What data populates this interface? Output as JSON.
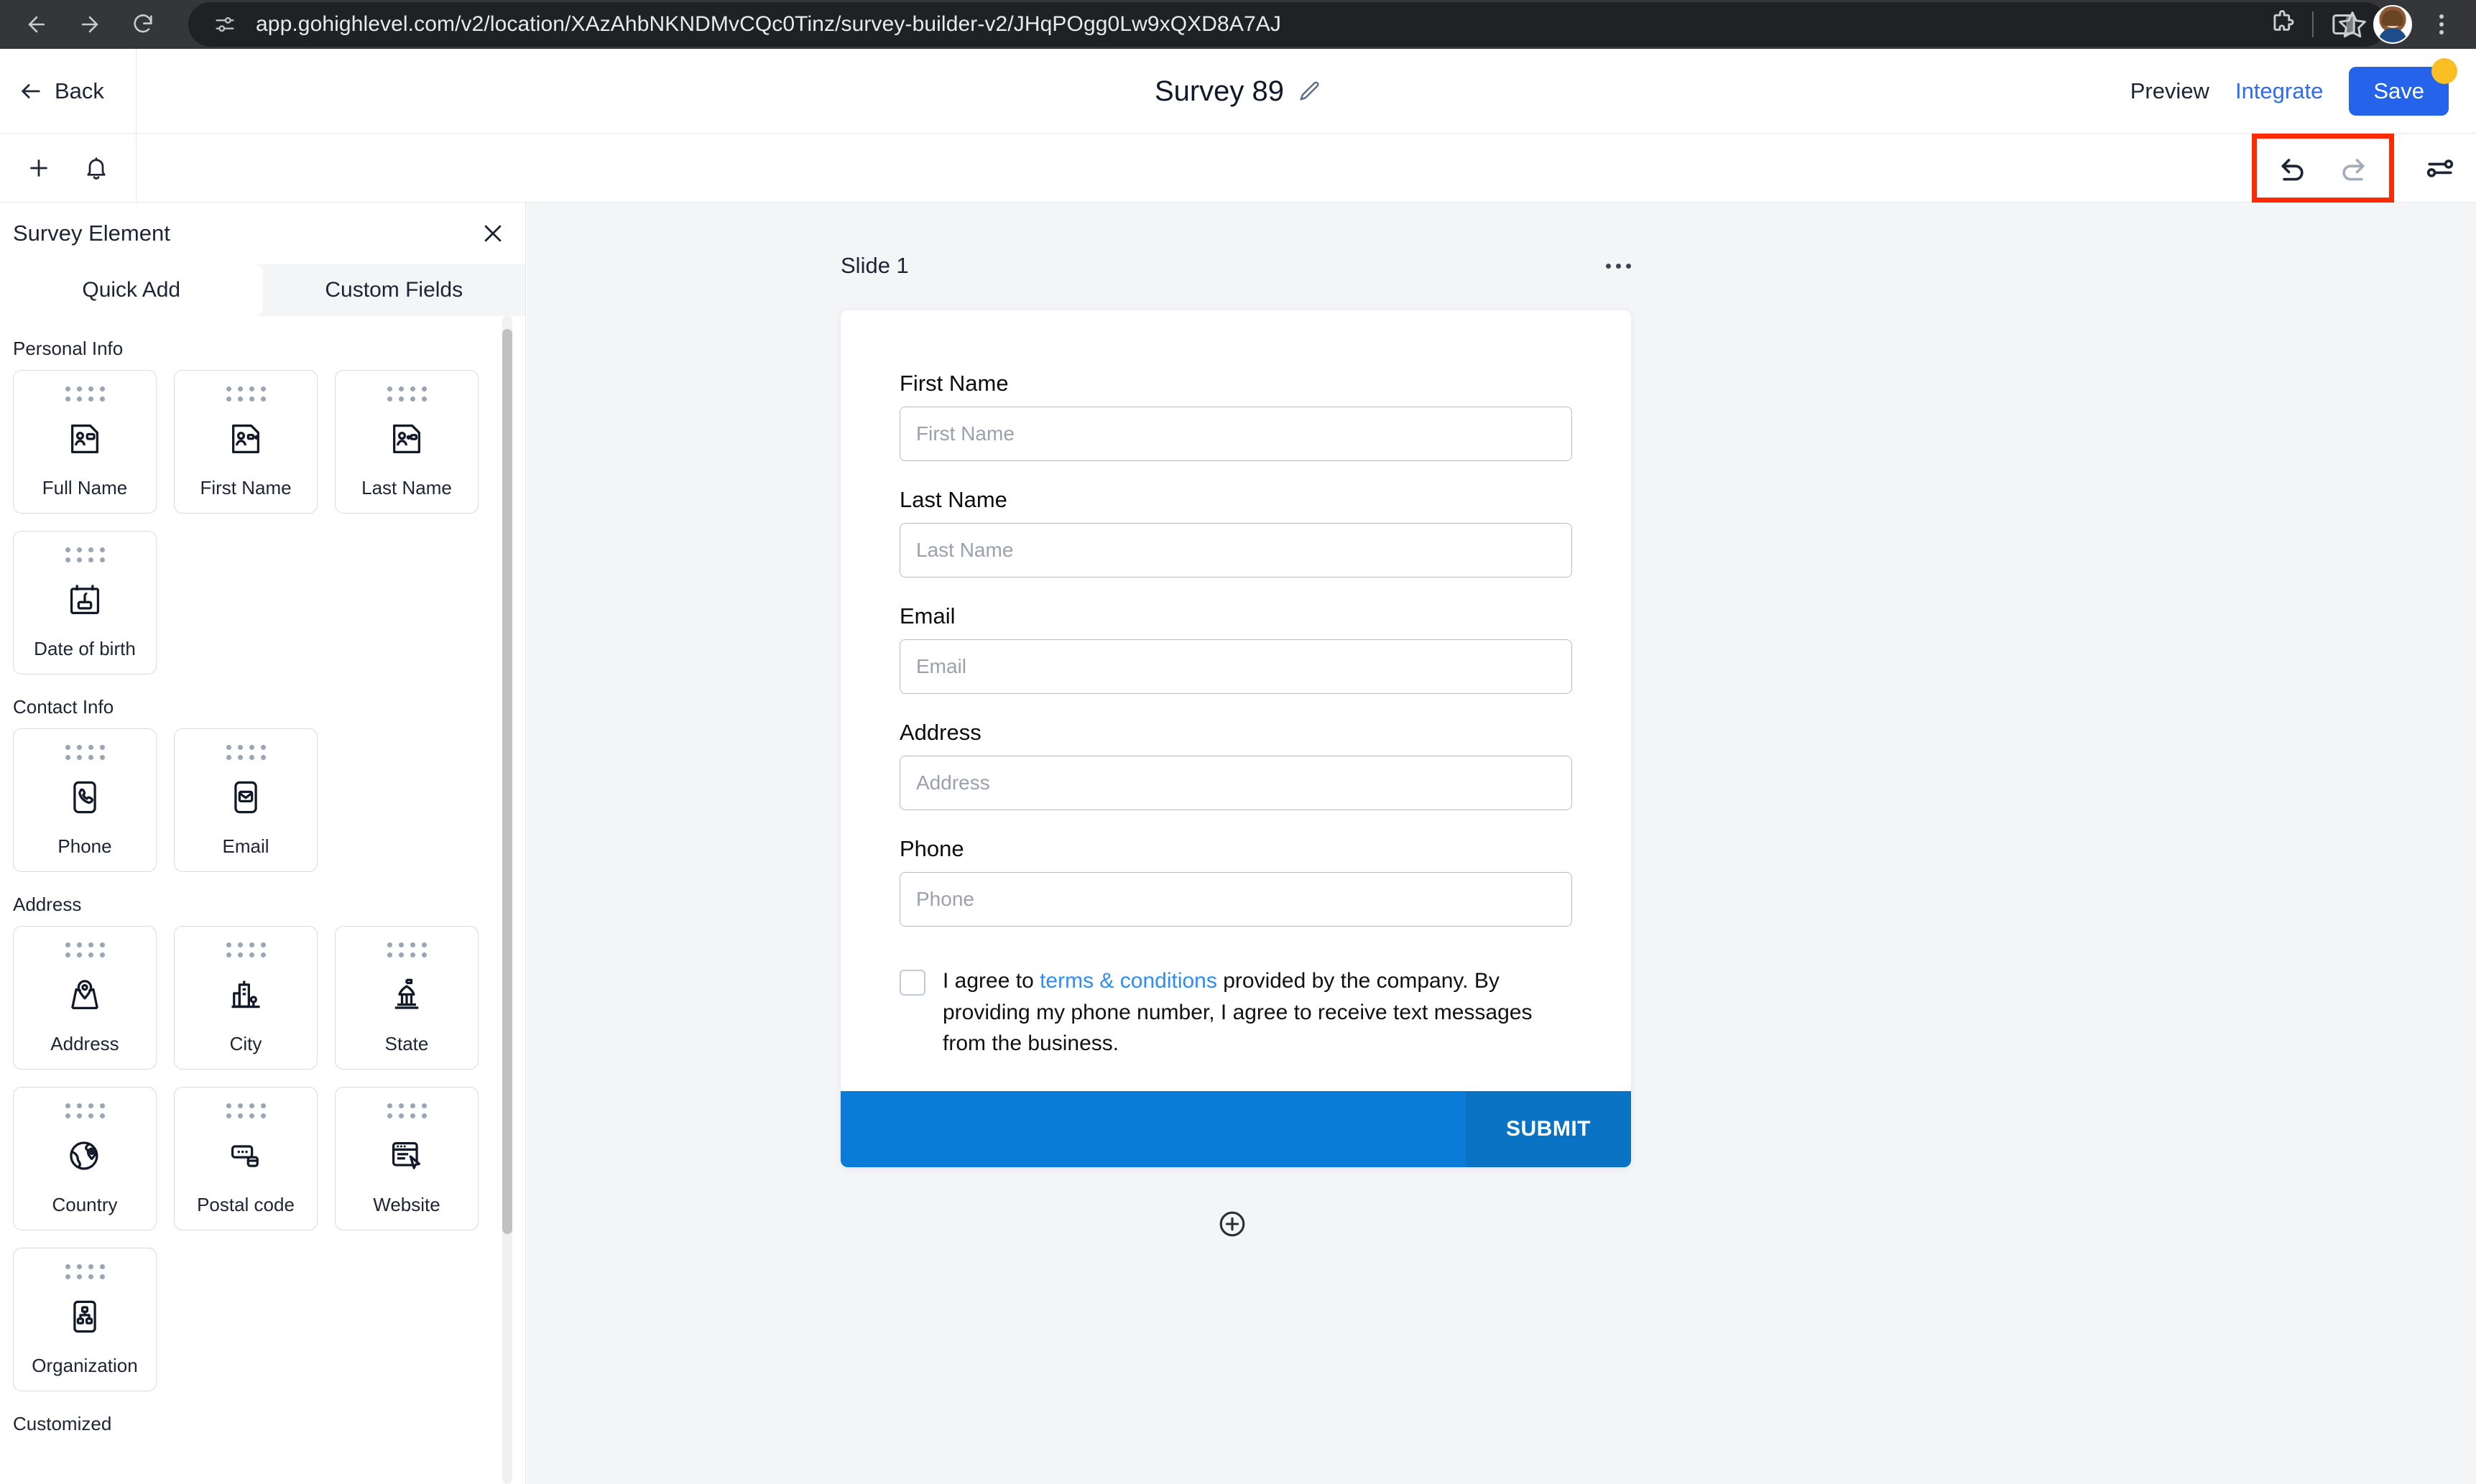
{
  "browser": {
    "url": "app.gohighlevel.com/v2/location/XAzAhbNKNDMvCQc0Tinz/survey-builder-v2/JHqPOgg0Lw9xQXD8A7AJ",
    "back_icon": "arrow-left-icon",
    "forward_icon": "arrow-right-icon",
    "reload_icon": "reload-icon",
    "site_info_icon": "site-settings-icon",
    "bookmark_icon": "star-icon",
    "extensions_icon": "puzzle-piece-icon",
    "side_panel_icon": "side-panel-icon",
    "profile_icon": "profile-avatar",
    "menu_icon": "kebab-menu-icon"
  },
  "header": {
    "back_label": "Back",
    "title": "Survey 89",
    "edit_icon": "pencil-icon",
    "preview_label": "Preview",
    "integrate_label": "Integrate",
    "save_label": "Save",
    "unsaved_indicator": "unsaved-dot",
    "save_color": "#2563eb",
    "unsaved_color": "#fbbf24",
    "integrate_color": "#2f6bf3"
  },
  "toolbar": {
    "add_icon": "plus-icon",
    "notification_icon": "bell-icon",
    "undo_icon": "undo-icon",
    "redo_icon": "redo-icon",
    "settings_icon": "sliders-icon",
    "highlight_color": "#fb2b06"
  },
  "panel": {
    "title": "Survey Element",
    "close_icon": "close-icon",
    "tabs": [
      {
        "label": "Quick Add",
        "active": true
      },
      {
        "label": "Custom Fields",
        "active": false
      }
    ],
    "groups": [
      {
        "label": "Personal Info",
        "items": [
          {
            "label": "Full Name",
            "icon": "contact-card-icon"
          },
          {
            "label": "First Name",
            "icon": "contact-card-icon"
          },
          {
            "label": "Last Name",
            "icon": "contact-card-icon"
          },
          {
            "label": "Date of birth",
            "icon": "birthday-calendar-icon"
          }
        ]
      },
      {
        "label": "Contact Info",
        "items": [
          {
            "label": "Phone",
            "icon": "phone-icon"
          },
          {
            "label": "Email",
            "icon": "envelope-icon"
          }
        ]
      },
      {
        "label": "Address",
        "items": [
          {
            "label": "Address",
            "icon": "map-pin-icon"
          },
          {
            "label": "City",
            "icon": "buildings-icon"
          },
          {
            "label": "State",
            "icon": "capitol-building-icon"
          },
          {
            "label": "Country",
            "icon": "globe-pin-icon"
          },
          {
            "label": "Postal code",
            "icon": "postal-code-icon"
          },
          {
            "label": "Website",
            "icon": "browser-window-icon"
          },
          {
            "label": "Organization",
            "icon": "org-chart-icon"
          }
        ]
      },
      {
        "label": "Customized",
        "items": []
      }
    ]
  },
  "canvas": {
    "slide_title": "Slide 1",
    "slide_menu_icon": "ellipsis-icon",
    "add_slide_icon": "plus-circle-icon",
    "fields": [
      {
        "label": "First Name",
        "placeholder": "First Name",
        "value": ""
      },
      {
        "label": "Last Name",
        "placeholder": "Last Name",
        "value": ""
      },
      {
        "label": "Email",
        "placeholder": "Email",
        "value": ""
      },
      {
        "label": "Address",
        "placeholder": "Address",
        "value": ""
      },
      {
        "label": "Phone",
        "placeholder": "Phone",
        "value": ""
      }
    ],
    "consent": {
      "checked": false,
      "text_before": "I agree to ",
      "link_text": "terms & conditions",
      "text_after": " provided by the company. By providing my phone number, I agree to receive text messages from the business.",
      "link_color": "#2f8bf5"
    },
    "submit_label": "SUBMIT",
    "submit_bar_color": "#0a7cd8",
    "submit_button_color": "#0b73c4"
  }
}
